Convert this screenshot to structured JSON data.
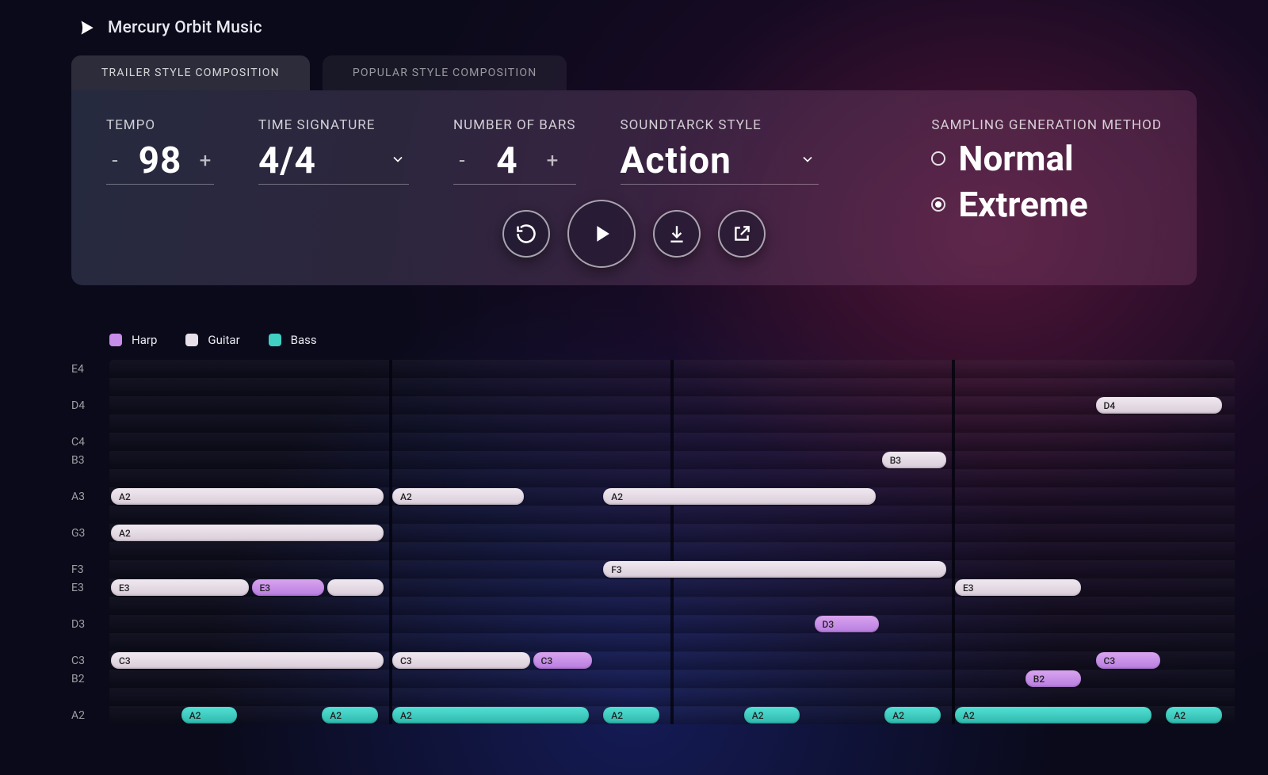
{
  "app": {
    "title": "Mercury Orbit Music"
  },
  "tabs": [
    {
      "label": "TRAILER STYLE COMPOSITION",
      "active": true
    },
    {
      "label": "POPULAR STYLE COMPOSITION",
      "active": false
    }
  ],
  "controls": {
    "tempo": {
      "label": "TEMPO",
      "value": "98"
    },
    "time_signature": {
      "label": "TIME SIGNATURE",
      "value": "4/4"
    },
    "num_bars": {
      "label": "NUMBER OF BARS",
      "value": "4"
    },
    "style": {
      "label": "SOUNDTARCK STYLE",
      "value": "Action"
    },
    "sampling": {
      "label": "SAMPLING GENERATION METHOD",
      "options": [
        {
          "label": "Normal",
          "selected": false
        },
        {
          "label": "Extreme",
          "selected": true
        }
      ]
    }
  },
  "legend": {
    "items": [
      {
        "label": "Harp",
        "color": "#c78de8"
      },
      {
        "label": "Guitar",
        "color": "#e8e0e8"
      },
      {
        "label": "Bass",
        "color": "#40d0c4"
      }
    ]
  },
  "piano_roll": {
    "num_bars": 4,
    "row_notes_top_to_bottom": [
      "E4",
      "",
      "D4",
      "",
      "C4",
      "B3",
      "",
      "A3",
      "",
      "G3",
      "",
      "F3",
      "E3",
      "",
      "D3",
      "",
      "C3",
      "B2",
      "",
      "A2"
    ],
    "labeled_rows": {
      "E4": 0,
      "D4": 2,
      "C4": 4,
      "B3": 5,
      "A3": 7,
      "G3": 9,
      "F3": 11,
      "E3": 12,
      "D3": 14,
      "C3": 16,
      "B2": 17,
      "A2": 19
    },
    "notes": [
      {
        "row": 2,
        "track": "guitar",
        "label": "D4",
        "start": 3.5,
        "len": 0.46
      },
      {
        "row": 5,
        "track": "guitar",
        "label": "B3",
        "start": 2.74,
        "len": 0.24
      },
      {
        "row": 7,
        "track": "guitar",
        "label": "A2",
        "start": 0.0,
        "len": 0.98
      },
      {
        "row": 7,
        "track": "guitar",
        "label": "A2",
        "start": 1.0,
        "len": 0.48
      },
      {
        "row": 7,
        "track": "guitar",
        "label": "A2",
        "start": 1.75,
        "len": 0.98
      },
      {
        "row": 9,
        "track": "guitar",
        "label": "A2",
        "start": 0.0,
        "len": 0.98
      },
      {
        "row": 11,
        "track": "guitar",
        "label": "F3",
        "start": 1.75,
        "len": 1.23
      },
      {
        "row": 12,
        "track": "guitar",
        "label": "E3",
        "start": 0.0,
        "len": 0.5
      },
      {
        "row": 12,
        "track": "harp",
        "label": "E3",
        "start": 0.5,
        "len": 0.27
      },
      {
        "row": 12,
        "track": "guitar",
        "label": "",
        "start": 0.77,
        "len": 0.21
      },
      {
        "row": 12,
        "track": "guitar",
        "label": "E3",
        "start": 3.0,
        "len": 0.46
      },
      {
        "row": 14,
        "track": "harp",
        "label": "D3",
        "start": 2.5,
        "len": 0.24
      },
      {
        "row": 16,
        "track": "guitar",
        "label": "C3",
        "start": 0.0,
        "len": 0.98
      },
      {
        "row": 16,
        "track": "guitar",
        "label": "C3",
        "start": 1.0,
        "len": 0.5
      },
      {
        "row": 16,
        "track": "harp",
        "label": "C3",
        "start": 1.5,
        "len": 0.22
      },
      {
        "row": 16,
        "track": "harp",
        "label": "C3",
        "start": 3.5,
        "len": 0.24
      },
      {
        "row": 17,
        "track": "harp",
        "label": "B2",
        "start": 3.25,
        "len": 0.21
      },
      {
        "row": 19,
        "track": "bass",
        "label": "A2",
        "start": 0.25,
        "len": 0.21
      },
      {
        "row": 19,
        "track": "bass",
        "label": "A2",
        "start": 0.75,
        "len": 0.21
      },
      {
        "row": 19,
        "track": "bass",
        "label": "A2",
        "start": 1.0,
        "len": 0.71
      },
      {
        "row": 19,
        "track": "bass",
        "label": "A2",
        "start": 1.75,
        "len": 0.21
      },
      {
        "row": 19,
        "track": "bass",
        "label": "A2",
        "start": 2.25,
        "len": 0.21
      },
      {
        "row": 19,
        "track": "bass",
        "label": "A2",
        "start": 2.75,
        "len": 0.21
      },
      {
        "row": 19,
        "track": "bass",
        "label": "A2",
        "start": 3.0,
        "len": 0.71
      },
      {
        "row": 19,
        "track": "bass",
        "label": "A2",
        "start": 3.75,
        "len": 0.21
      }
    ]
  }
}
